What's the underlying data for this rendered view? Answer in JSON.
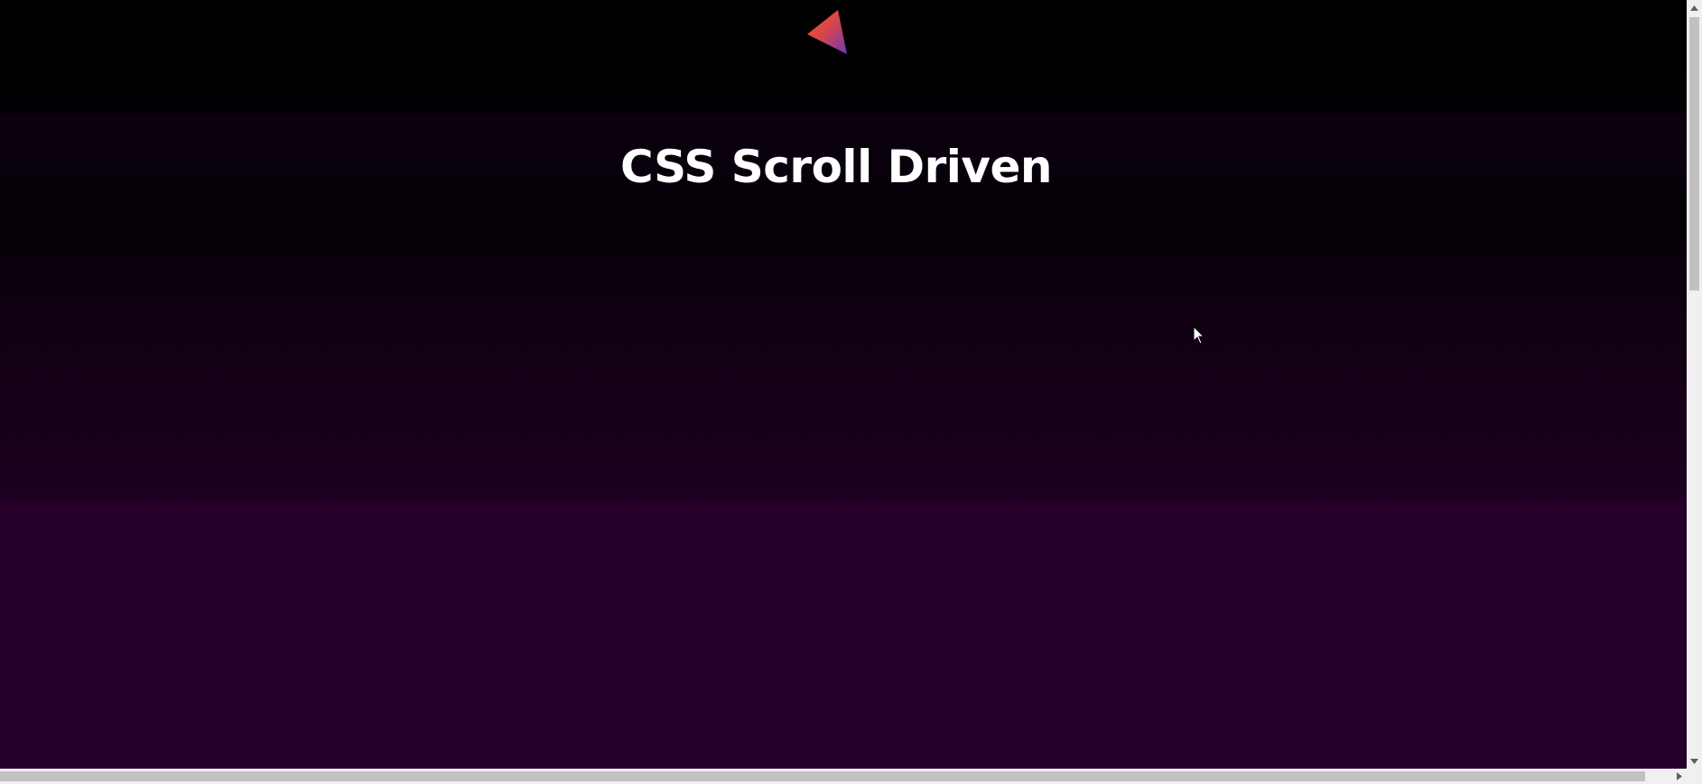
{
  "page": {
    "heading": "CSS Scroll Driven",
    "logo_icon": "triangle-logo-icon",
    "background_colors": [
      "#000000",
      "#0c0010",
      "#26002a"
    ],
    "logo_gradient": [
      "#ff4f1f",
      "#b03a8c",
      "#7a3fb0"
    ]
  },
  "scrollbars": {
    "vertical": {
      "up_icon": "arrow-up-icon",
      "down_icon": "arrow-down-icon"
    },
    "horizontal": {
      "right_icon": "arrow-right-icon"
    }
  },
  "cursor_icon": "mouse-pointer-icon"
}
